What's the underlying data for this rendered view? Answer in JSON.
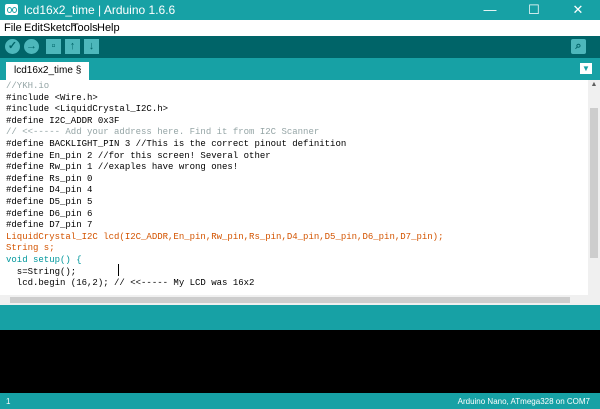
{
  "window": {
    "title": "lcd16x2_time | Arduino 1.6.6",
    "controls": {
      "minimize": "—",
      "maximize": "☐",
      "close": "✕"
    }
  },
  "menu": [
    "File",
    "Edit",
    "Sketch",
    "Tools",
    "Help"
  ],
  "toolbar": {
    "verify": "✓",
    "upload": "→",
    "new": "▫",
    "open": "↑",
    "save": "↓",
    "serial_monitor": "⌕"
  },
  "tab": {
    "label": "lcd16x2_time §",
    "menu_icon": "▼"
  },
  "editor": {
    "lines": [
      "//YKH.io",
      "#include <Wire.h>",
      "#include <LiquidCrystal_I2C.h>",
      "#define I2C_ADDR 0x3F",
      "// <<----- Add your address here. Find it from I2C Scanner",
      "#define BACKLIGHT_PIN 3 //This is the correct pinout definition",
      "#define En_pin 2 //for this screen! Several other",
      "#define Rw_pin 1 //exaples have wrong ones!",
      "#define Rs_pin 0",
      "#define D4_pin 4",
      "#define D5_pin 5",
      "#define D6_pin 6",
      "#define D7_pin 7",
      "LiquidCrystal_I2C lcd(I2C_ADDR,En_pin,Rw_pin,Rs_pin,D4_pin,D5_pin,D6_pin,D7_pin);",
      "String s;",
      "void setup() {",
      "  s=String();",
      "  lcd.begin (16,2); // <<----- My LCD was 16x2"
    ]
  },
  "status": {
    "line_number": "1",
    "board": "Arduino Nano, ATmega328 on COM7"
  },
  "colors": {
    "teal_dark": "#006468",
    "teal": "#17a1a5",
    "keyword_green": "#5e6d03",
    "keyword_orange": "#d35400",
    "keyword_blue": "#00979c"
  }
}
